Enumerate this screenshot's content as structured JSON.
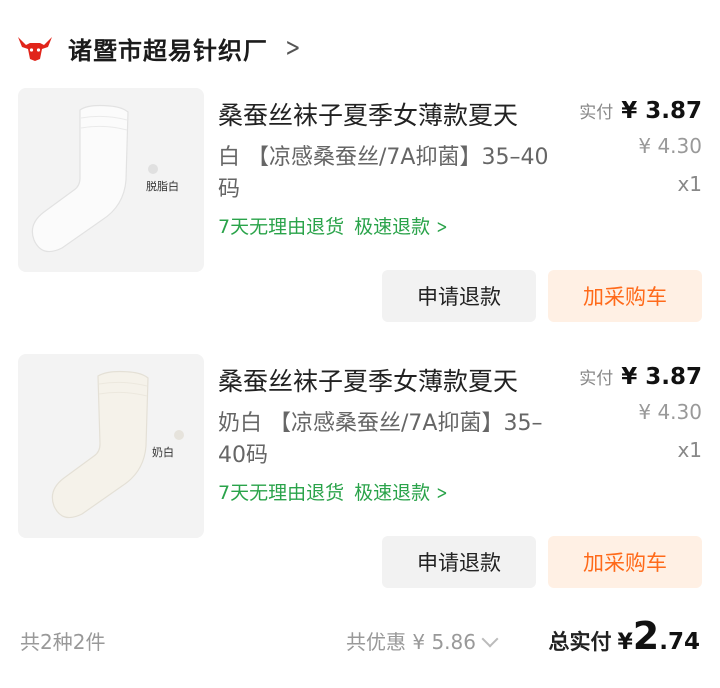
{
  "shop": {
    "name": "诸暨市超易针织厂",
    "brand_color": "#e1251b"
  },
  "items": [
    {
      "title": "桑蚕丝袜子夏季女薄款夏天",
      "spec": "白 【凉感桑蚕丝/7A抑菌】35–40码",
      "swatch_label": "脱脂白",
      "sock_color": "#fbfbfb",
      "return_policy": "7天无理由退货",
      "fast_refund": "极速退款",
      "actual_label": "实付",
      "actual_price": "¥ 3.87",
      "original_price": "¥ 4.30",
      "quantity": "x1",
      "refund_button": "申请退款",
      "cart_button": "加采购车"
    },
    {
      "title": "桑蚕丝袜子夏季女薄款夏天",
      "spec": "奶白 【凉感桑蚕丝/7A抑菌】35–40码",
      "swatch_label": "奶白",
      "sock_color": "#f5f2ea",
      "return_policy": "7天无理由退货",
      "fast_refund": "极速退款",
      "actual_label": "实付",
      "actual_price": "¥ 3.87",
      "original_price": "¥ 4.30",
      "quantity": "x1",
      "refund_button": "申请退款",
      "cart_button": "加采购车"
    }
  ],
  "summary": {
    "count_text": "共2种2件",
    "discount_text": "共优惠 ¥ 5.86",
    "total_label": "总实付",
    "total_currency": "¥",
    "total_integer": "2",
    "total_decimal": ".74"
  },
  "colors": {
    "green": "#2aa34a",
    "orange": "#ff6a1a",
    "orange_bg": "#fff0e4"
  },
  "icons": {
    "logo": "bull-head-icon",
    "shop_link": "chevron-right-icon",
    "policy_link": "chevron-right-icon",
    "discount_expand": "chevron-down-icon"
  }
}
